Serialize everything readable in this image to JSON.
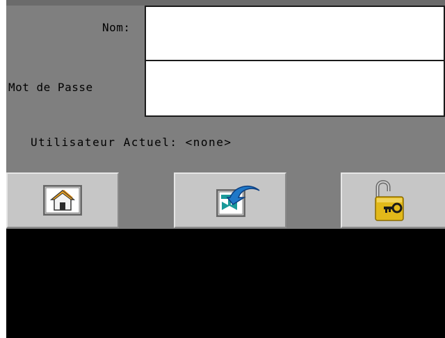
{
  "form": {
    "name_label": "Nom:",
    "name_value": "",
    "password_label": "Mot de Passe",
    "password_value": ""
  },
  "status": {
    "current_user_text": "Utilisateur Actuel: <none>"
  },
  "toolbar": {
    "buttons": [
      {
        "icon": "home-icon"
      },
      {
        "icon": "return-icon"
      },
      {
        "icon": "unlock-icon"
      }
    ]
  },
  "colors": {
    "panel": "#7f7f7f",
    "button": "#c6c6c6",
    "background": "#000000",
    "icon_gold": "#e2b91a",
    "icon_blue": "#1f78c8",
    "icon_teal": "#1a9a9a"
  }
}
